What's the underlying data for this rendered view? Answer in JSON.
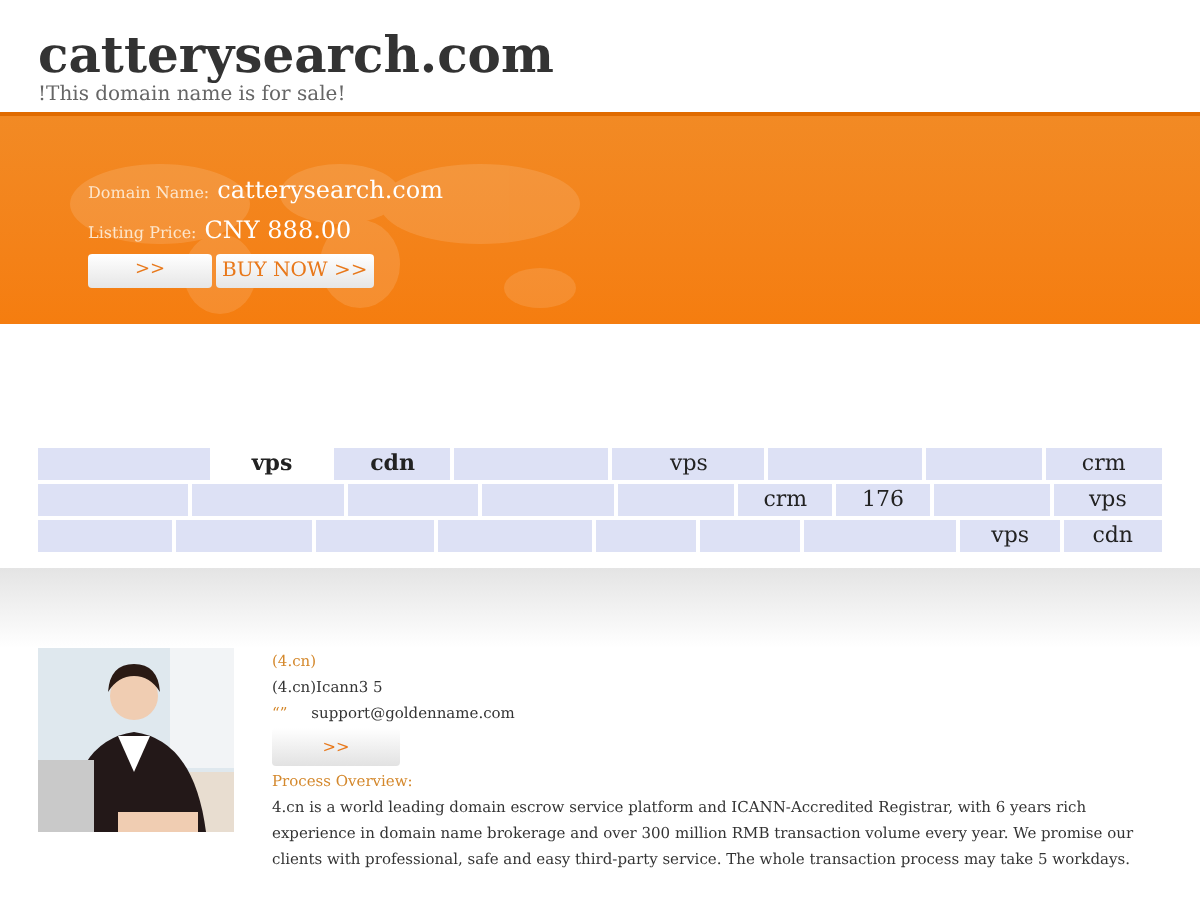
{
  "header": {
    "title": "catterysearch.com",
    "subtitle": "!This domain name is for sale!"
  },
  "banner": {
    "domain_label": "Domain Name:",
    "domain": "catterysearch.com",
    "price_label": "Listing Price:",
    "price": "CNY 888.00",
    "buttons": [
      ">>",
      "BUY NOW >>"
    ]
  },
  "tag_rows": [
    {
      "tags": [
        {
          "kind": "blank"
        },
        {
          "kind": "tag",
          "text": "vps",
          "bold": true,
          "selected": true
        },
        {
          "kind": "tag",
          "text": "cdn",
          "bold": true,
          "selected": false
        },
        {
          "kind": "blank"
        },
        {
          "kind": "tag",
          "text": "vps",
          "bold": false,
          "selected": false
        },
        {
          "kind": "blank"
        },
        {
          "kind": "blank"
        },
        {
          "kind": "tag",
          "text": "crm",
          "bold": false,
          "selected": false
        }
      ]
    },
    {
      "tags": [
        {
          "kind": "blank"
        },
        {
          "kind": "blank"
        },
        {
          "kind": "blank"
        },
        {
          "kind": "blank"
        },
        {
          "kind": "blank"
        },
        {
          "kind": "tag",
          "text": "crm",
          "bold": false,
          "selected": false
        },
        {
          "kind": "tag",
          "text": "176",
          "bold": false,
          "selected": false
        },
        {
          "kind": "blank"
        },
        {
          "kind": "tag",
          "text": "vps",
          "bold": false,
          "selected": false
        }
      ]
    },
    {
      "tags": [
        {
          "kind": "blank"
        },
        {
          "kind": "blank"
        },
        {
          "kind": "blank"
        },
        {
          "kind": "blank"
        },
        {
          "kind": "blank"
        },
        {
          "kind": "blank"
        },
        {
          "kind": "blank"
        },
        {
          "kind": "tag",
          "text": "vps",
          "bold": false,
          "selected": false
        },
        {
          "kind": "tag",
          "text": "cdn",
          "bold": false,
          "selected": false
        }
      ]
    }
  ],
  "contact": {
    "heading": "(4.cn)",
    "line": "(4.cn)Icann3 5",
    "mark": "“”",
    "email": "support@goldenname.com",
    "button": ">>",
    "process_title": "Process Overview:",
    "paragraph": "4.cn is a world leading domain escrow service platform and ICANN-Accredited Registrar, with 6 years rich experience in domain name brokerage and over 300 million RMB transaction volume every year. We promise our clients with professional, safe and easy third-party service. The whole transaction process may take 5 workdays."
  }
}
